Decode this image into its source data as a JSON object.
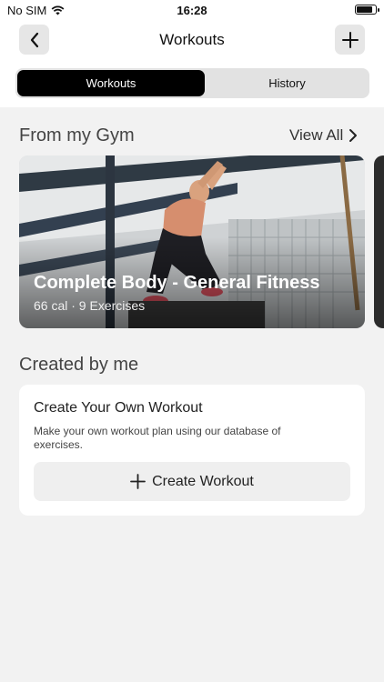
{
  "status": {
    "carrier": "No SIM",
    "time": "16:28",
    "battery_level": 0.9
  },
  "nav": {
    "title": "Workouts",
    "back_icon": "chevron-left-icon",
    "add_icon": "plus-icon"
  },
  "tabs": [
    {
      "label": "Workouts",
      "active": true
    },
    {
      "label": "History",
      "active": false
    }
  ],
  "gym_section": {
    "title": "From my Gym",
    "view_all": "View All",
    "card": {
      "title": "Complete Body - General Fitness",
      "meta": "66 cal · 9 Exercises"
    }
  },
  "created_section": {
    "title": "Created by me",
    "card": {
      "title": "Create Your Own Workout",
      "description": "Make your own workout plan using our database of exercises.",
      "button_label": "Create Workout"
    }
  },
  "colors": {
    "accent": "#000000",
    "background": "#f2f2f2",
    "card": "#ffffff"
  }
}
